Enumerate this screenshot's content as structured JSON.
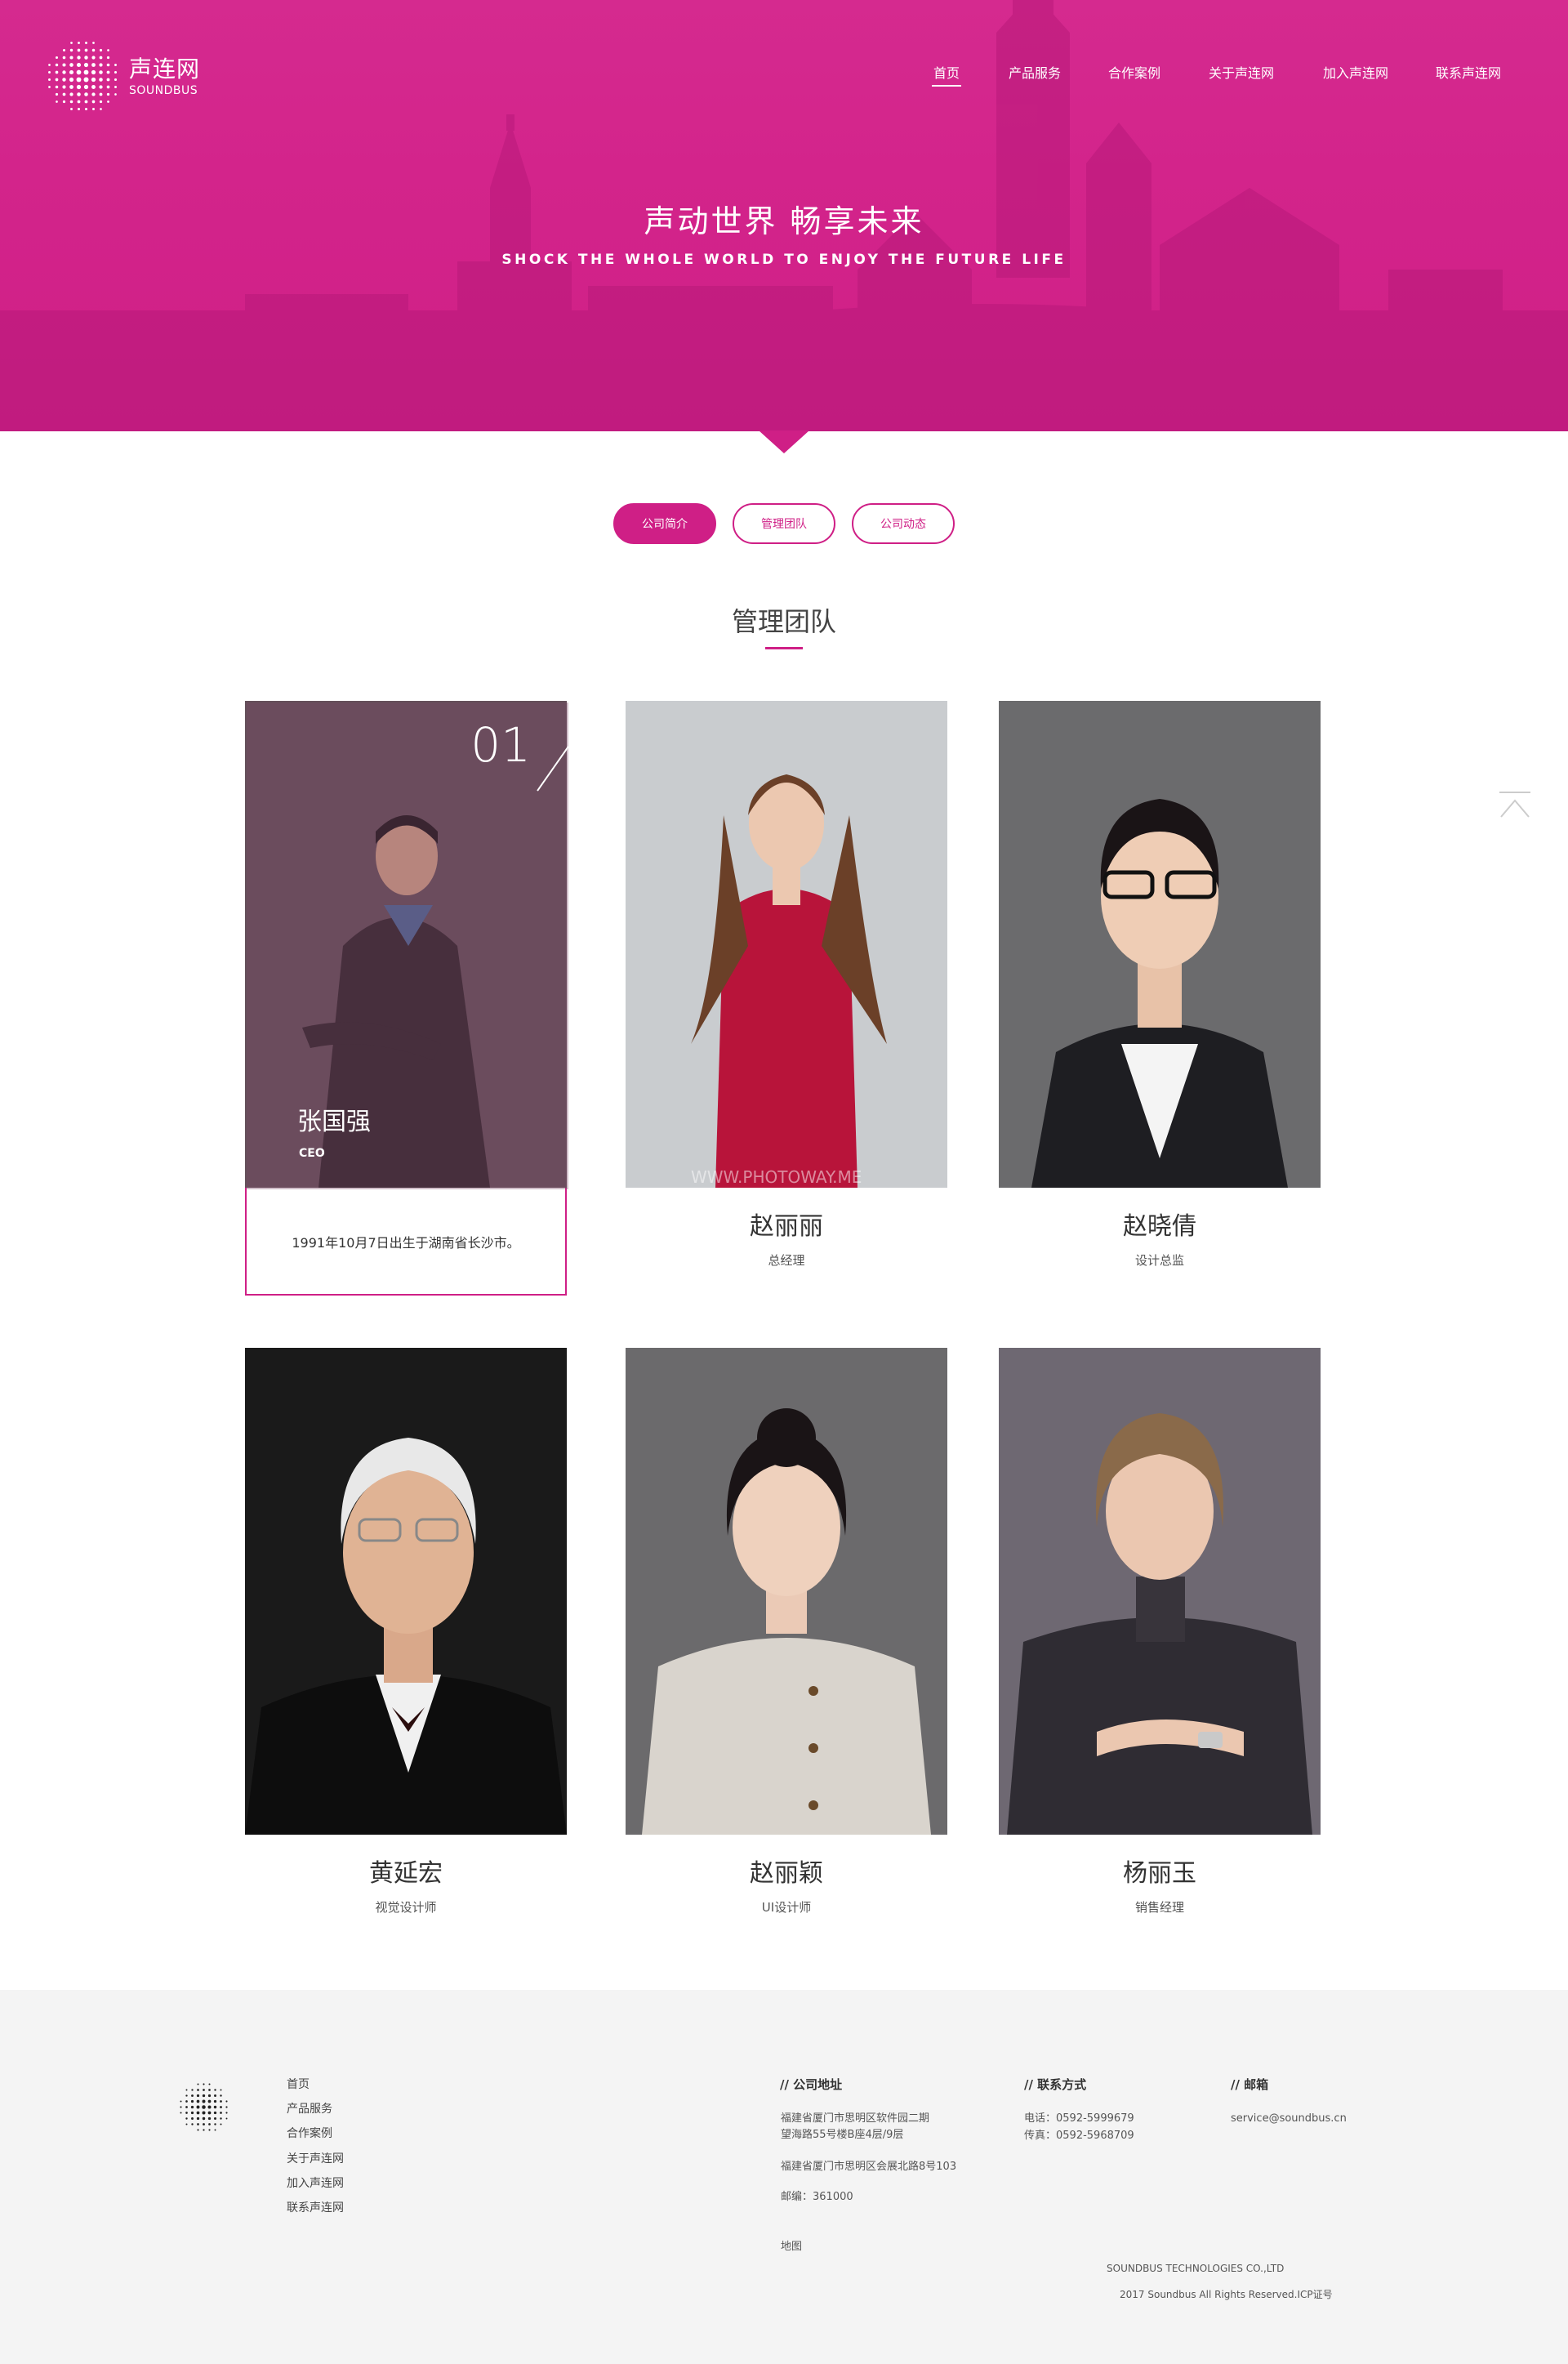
{
  "brand": {
    "name_cn": "声连网",
    "name_en": "SOUNDBUS"
  },
  "nav": [
    "首页",
    "产品服务",
    "合作案例",
    "关于声连网",
    "加入声连网",
    "联系声连网"
  ],
  "hero": {
    "title": "声动世界 畅享未来",
    "subtitle": "SHOCK THE WHOLE WORLD TO  ENJOY THE FUTURE LIFE"
  },
  "tabs": [
    "公司简介",
    "管理团队",
    "公司动态"
  ],
  "section_title": "管理团队",
  "featured": {
    "number": "01",
    "name": "张国强",
    "role": "CEO",
    "bio": "1991年10月7日出生于湖南省长沙市。"
  },
  "members": [
    {
      "name": "赵丽丽",
      "role": "总经理",
      "watermark": "WWW.PHOTOWAY.ME"
    },
    {
      "name": "赵晓倩",
      "role": "设计总监"
    },
    {
      "name": "黄延宏",
      "role": "视觉设计师"
    },
    {
      "name": "赵丽颖",
      "role": "UI设计师"
    },
    {
      "name": "杨丽玉",
      "role": "销售经理"
    }
  ],
  "footer": {
    "nav": [
      "首页",
      "产品服务",
      "合作案例",
      "关于声连网",
      "加入声连网",
      "联系声连网"
    ],
    "address_title": "// 公司地址",
    "address_1": "福建省厦门市思明区软件园二期",
    "address_2": "望海路55号楼B座4层/9层",
    "address_3": "福建省厦门市思明区会展北路8号103",
    "postcode": "邮编：361000",
    "map": "地图",
    "contact_title": "// 联系方式",
    "phone": "电话：0592-5999679",
    "fax": "传真：0592-5968709",
    "email_title": "// 邮箱",
    "email": "service@soundbus.cn",
    "company": "SOUNDBUS TECHNOLOGIES CO.,LTD",
    "copyright": "2017 Soundbus All Rights Reserved.ICP证号"
  },
  "colors": {
    "accent": "#cf1f86",
    "footer_bg": "#f4f4f4"
  }
}
